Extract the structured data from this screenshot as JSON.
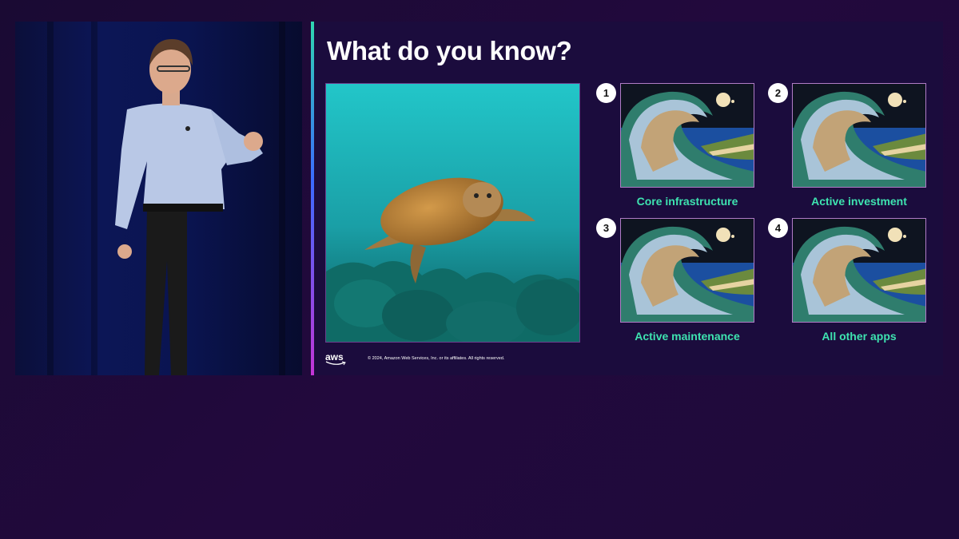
{
  "slide": {
    "title": "What do you know?",
    "copyright": "© 2024, Amazon Web Services, Inc. or its affiliates. All rights reserved.",
    "logo_text": "aws"
  },
  "cards": [
    {
      "number": "1",
      "label": "Core infrastructure"
    },
    {
      "number": "2",
      "label": "Active investment"
    },
    {
      "number": "3",
      "label": "Active maintenance"
    },
    {
      "number": "4",
      "label": "All other apps"
    }
  ],
  "colors": {
    "background": "#22093d",
    "label_green": "#3ee3b0",
    "slide_bg": "#1b0c3d"
  }
}
